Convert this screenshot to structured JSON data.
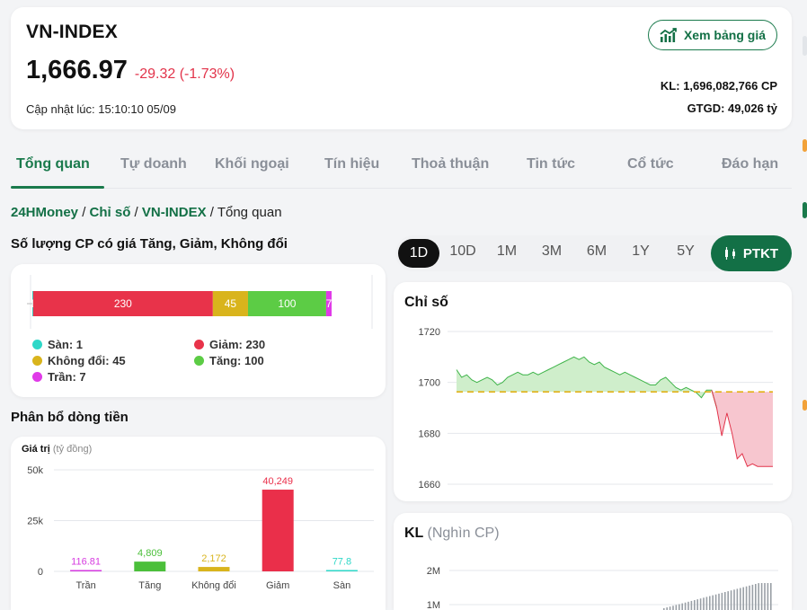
{
  "header": {
    "ticker": "VN-INDEX",
    "price": "1,666.97",
    "change": "-29.32 (-1.73%)",
    "updated": "Cập nhật lúc: 15:10:10 05/09",
    "board_button": "Xem bảng giá",
    "volume": "KL: 1,696,082,766 CP",
    "value": "GTGD: 49,026 tỷ"
  },
  "tabs": [
    "Tổng quan",
    "Tự doanh",
    "Khối ngoại",
    "Tín hiệu",
    "Thoả thuận",
    "Tin tức",
    "Cổ tức",
    "Đáo hạn"
  ],
  "breadcrumb": {
    "site": "24HMoney",
    "sep": " / ",
    "section": "Chỉ số",
    "index": "VN-INDEX",
    "current": "Tổng quan"
  },
  "breadth": {
    "title": "Số lượng CP có giá Tăng, Giảm, Không đổi",
    "legend": [
      {
        "label": "Sàn: 1",
        "color": "#2ed8c8"
      },
      {
        "label": "Giảm: 230",
        "color": "#e8334a"
      },
      {
        "label": "Không đổi: 45",
        "color": "#d9b41c"
      },
      {
        "label": "Tăng: 100",
        "color": "#5ccc45"
      },
      {
        "label": "Trần: 7",
        "color": "#e03ae8"
      }
    ],
    "segments": [
      {
        "label": "1",
        "value": 1,
        "color": "#2ed8c8"
      },
      {
        "label": "230",
        "value": 230,
        "color": "#e8334a"
      },
      {
        "label": "45",
        "value": 45,
        "color": "#d9b41c"
      },
      {
        "label": "100",
        "value": 100,
        "color": "#5ccc45"
      },
      {
        "label": "7",
        "value": 7,
        "color": "#e03ae8"
      }
    ]
  },
  "money_flow": {
    "title": "Phân bổ dòng tiền",
    "y_title": "Giá trị",
    "y_unit": "(tỷ đồng)",
    "chart_data": {
      "type": "bar",
      "categories": [
        "Trần",
        "Tăng",
        "Không đổi",
        "Giảm",
        "Sàn"
      ],
      "values": [
        116.81,
        4809,
        2172,
        40249,
        77.8
      ],
      "value_labels": [
        "116.81",
        "4,809",
        "2,172",
        "40,249",
        "77.8"
      ],
      "colors": [
        "#d63ae0",
        "#4bbf3a",
        "#d9b41c",
        "#ea2f4a",
        "#2ed8c8"
      ],
      "yticks": [
        "50k",
        "25k",
        "0"
      ],
      "ylim": [
        0,
        50000
      ]
    }
  },
  "periods": [
    "1D",
    "10D",
    "1M",
    "3M",
    "6M",
    "1Y",
    "5Y"
  ],
  "ptkt_button": "PTKT",
  "index_chart": {
    "title": "Chỉ số",
    "chart_data": {
      "type": "area",
      "yticks": [
        "1720",
        "1700",
        "1680",
        "1660"
      ],
      "ylim": [
        1655,
        1724
      ],
      "reference": 1696.29,
      "y": [
        1705,
        1702,
        1703,
        1701,
        1700,
        1701,
        1702,
        1701,
        1699,
        1700,
        1702,
        1703,
        1704,
        1703,
        1703,
        1704,
        1703,
        1704,
        1705,
        1706,
        1707,
        1708,
        1709,
        1710,
        1709,
        1710,
        1708,
        1707,
        1708,
        1706,
        1705,
        1704,
        1703,
        1704,
        1703,
        1702,
        1701,
        1700,
        1699,
        1699,
        1701,
        1702,
        1700,
        1698,
        1697,
        1698,
        1697,
        1696,
        1694,
        1697,
        1697,
        1690,
        1679,
        1688,
        1680,
        1670,
        1672,
        1667,
        1668,
        1667,
        1667,
        1667,
        1667
      ]
    }
  },
  "volume_chart": {
    "title": "KL",
    "unit": "(Nghìn CP)",
    "yticks": [
      "2M",
      "1M"
    ]
  }
}
